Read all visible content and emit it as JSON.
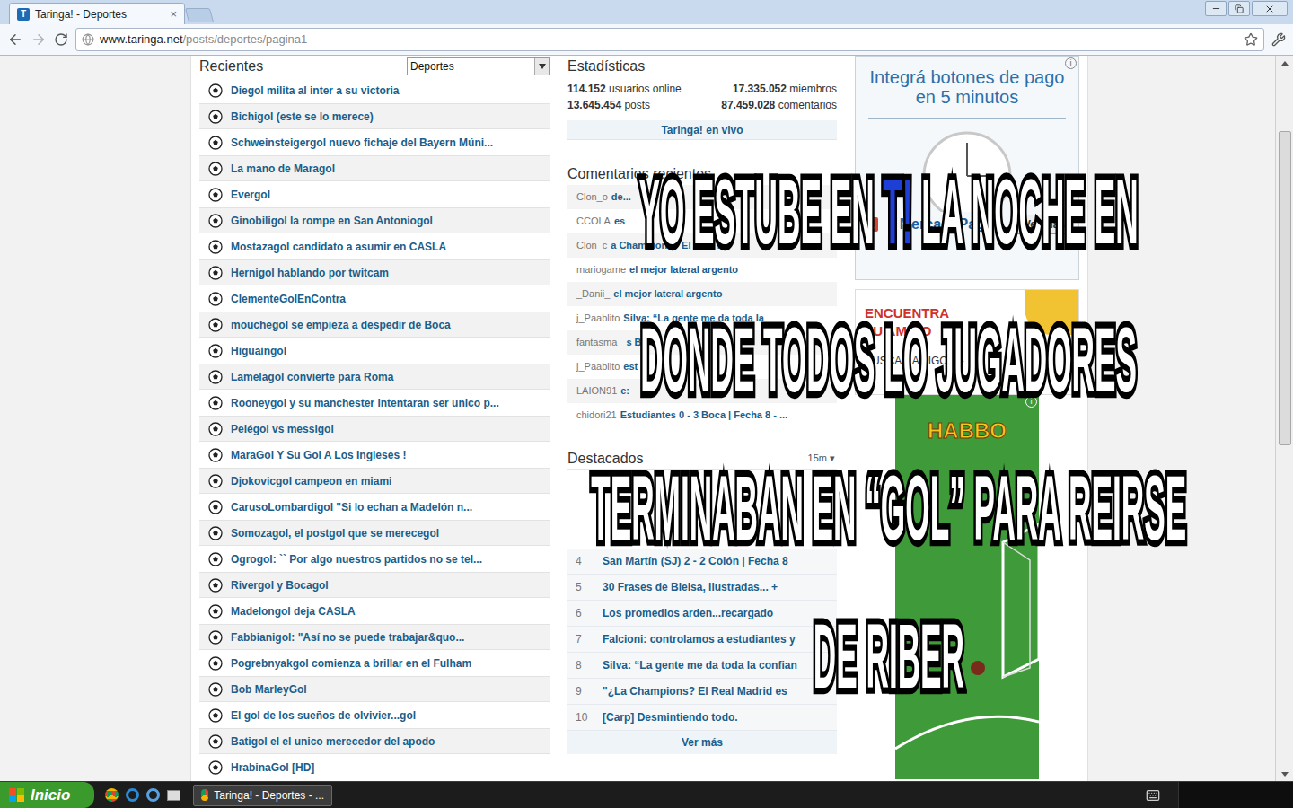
{
  "browser": {
    "tab_title": "Taringa! - Deportes",
    "tab_icon": "T",
    "tab_close": "×",
    "url_domain": "www.taringa.net",
    "url_path": "/posts/deportes/pagina1"
  },
  "recientes": {
    "title": "Recientes",
    "filter": "Deportes",
    "items": [
      "Diegol milita al inter a su victoria",
      "Bichigol (este se lo merece)",
      "Schweinsteigergol nuevo fichaje del Bayern Múni...",
      "La mano de Maragol",
      "Evergol",
      "Ginobiligol la rompe en San Antoniogol",
      "Mostazagol candidato a asumir en CASLA",
      "Hernigol hablando por twitcam",
      "ClementeGolEnContra",
      "mouchegol se empieza a despedir de Boca",
      "Higuaingol",
      "Lamelagol convierte para Roma",
      "Rooneygol y su manchester intentaran ser unico p...",
      "Pelégol vs messigol",
      "MaraGol Y Su Gol A Los Ingleses !",
      "Djokovicgol campeon en miami",
      "CarusoLombardigol \"Si lo echan a Madelón n...",
      "Somozagol, el postgol que se merecegol",
      "Ogrogol: `` Por algo nuestros partidos no se tel...",
      "Rivergol y Bocagol",
      "Madelongol deja CASLA",
      "Fabbianigol: \"Así no se puede trabajar&quo...",
      "Pogrebnyakgol comienza a brillar en el Fulham",
      "Bob MarleyGol",
      "El gol de los sueños de olvivier...gol",
      "Batigol el el unico merecedor del apodo",
      "HrabinaGol [HD]"
    ]
  },
  "stats": {
    "title": "Estadísticas",
    "rows": [
      [
        {
          "value": "114.152",
          "label": "usuarios online"
        },
        {
          "value": "17.335.052",
          "label": "miembros"
        }
      ],
      [
        {
          "value": "13.645.454",
          "label": "posts"
        },
        {
          "value": "87.459.028",
          "label": "comentarios"
        }
      ]
    ],
    "live_button": "Taringa! en vivo"
  },
  "comments": {
    "title": "Comentarios recientes",
    "items": [
      {
        "user": "Clon_o",
        "text": "de..."
      },
      {
        "user": "CCOLA",
        "text": "es"
      },
      {
        "user": "Clon_c",
        "text": "a Champions? El Real M"
      },
      {
        "user": "mariogame",
        "text": "el mejor lateral argento"
      },
      {
        "user": "_Danii_",
        "text": "el mejor lateral argento"
      },
      {
        "user": "j_Paablito",
        "text": "Silva: “La gente me da toda la"
      },
      {
        "user": "fantasma_",
        "text": "s B"
      },
      {
        "user": "j_Paablito",
        "text": "est"
      },
      {
        "user": "LAION91",
        "text": "e:"
      },
      {
        "user": "chidori21",
        "text": "Estudiantes 0 - 3 Boca | Fecha 8 - ..."
      }
    ]
  },
  "destacados": {
    "title": "Destacados",
    "period": "15m",
    "items": [
      {
        "rank": "4",
        "text": "San Martín (SJ) 2 - 2 Colón | Fecha 8"
      },
      {
        "rank": "5",
        "text": "30 Frases de Bielsa, ilustradas... +"
      },
      {
        "rank": "6",
        "text": "Los promedios arden...recargado"
      },
      {
        "rank": "7",
        "text": "Falcioni: controlamos a estudiantes y"
      },
      {
        "rank": "8",
        "text": "Silva: “La gente me da toda la confian"
      },
      {
        "rank": "9",
        "text": "\"¿La Champions? El Real Madrid es"
      },
      {
        "rank": "10",
        "text": "[Carp] Desmintiendo todo."
      }
    ],
    "more": "Ver más"
  },
  "ads": {
    "mercadopago": {
      "headline": [
        "Integrá botones de pago",
        "en 5 minutos"
      ],
      "brand": "MercadoPago",
      "button": "Ver más",
      "plus_one": "+1",
      "info": "i"
    },
    "amigos": {
      "headline": [
        "ENCUENTRA",
        "TU AMIGO"
      ],
      "button": "BUSCAR AMIGOS »"
    },
    "habbo": {
      "logo": "HABBO",
      "info": "i"
    }
  },
  "overlay": {
    "lines": [
      [
        {
          "text": "YO ESTUBE EN ",
          "color": "#ffffff"
        },
        {
          "text": "T!",
          "color": "#1d3fd6"
        },
        {
          "text": " LA NOCHE EN",
          "color": "#ffffff"
        }
      ],
      [
        {
          "text": "DONDE TODOS LO JUGADORES",
          "color": "#ffffff"
        }
      ],
      [
        {
          "text": "TERMINABAN EN “GOL” PARA REIRSE",
          "color": "#ffffff"
        }
      ],
      [
        {
          "text": "DE RIBER",
          "color": "#ffffff"
        }
      ]
    ]
  },
  "taskbar": {
    "start": "Inicio",
    "tasks": [
      {
        "label": "Taringa! - Deportes - ...",
        "selected": true
      }
    ]
  }
}
